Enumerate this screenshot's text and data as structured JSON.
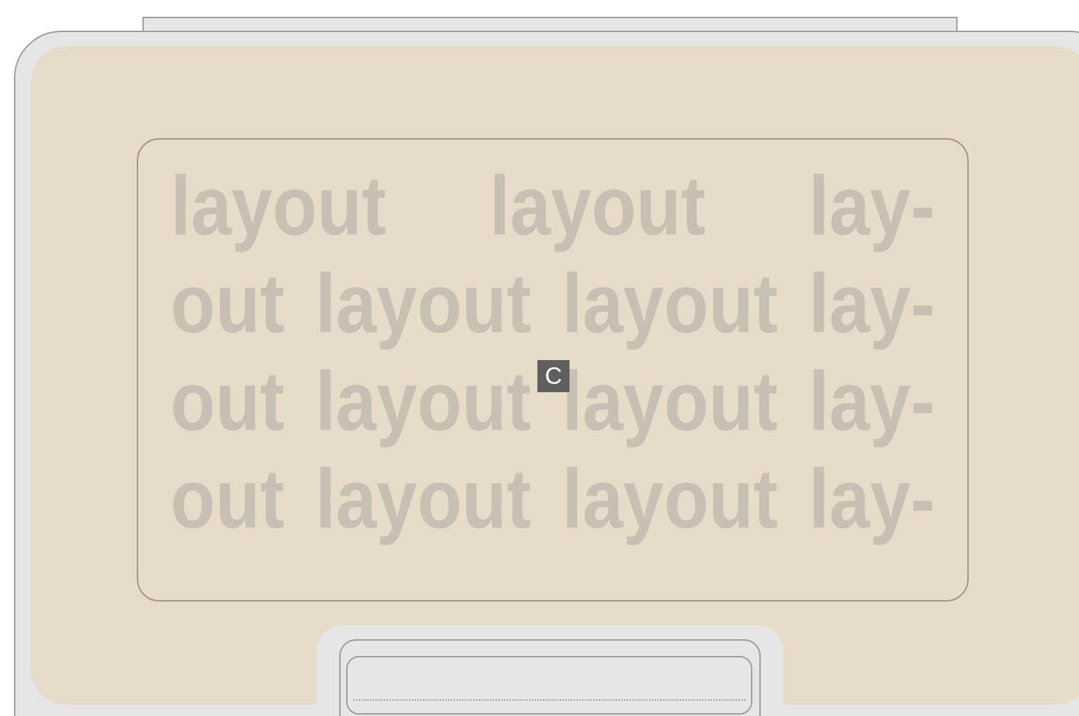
{
  "text_lines": [
    "layout layout lay-",
    "out layout layout lay-",
    "out layout layout lay-",
    "out layout layout lay-"
  ],
  "badge": "C"
}
